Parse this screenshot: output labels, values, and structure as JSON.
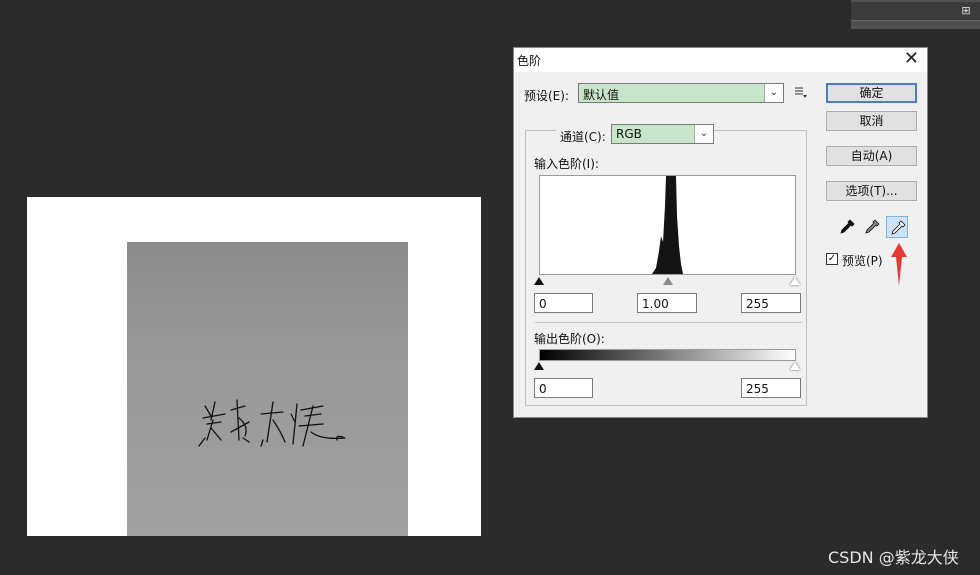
{
  "dialog": {
    "title": "色阶",
    "close_icon": "close-icon",
    "preset_label": "预设(E):",
    "preset_value": "默认值",
    "channel_label": "通道(C):",
    "channel_value": "RGB",
    "input_levels_label": "输入色阶(I):",
    "input_black": "0",
    "input_gamma": "1.00",
    "input_white": "255",
    "output_levels_label": "输出色阶(O):",
    "output_black": "0",
    "output_white": "255",
    "buttons": {
      "ok": "确定",
      "cancel": "取消",
      "auto": "自动(A)",
      "options": "选项(T)..."
    },
    "preview_label": "预览(P)",
    "preview_checked": true,
    "droppers": [
      "black-eyedropper-icon",
      "gray-eyedropper-icon",
      "white-eyedropper-icon"
    ],
    "active_dropper": "white-eyedropper-icon"
  },
  "colors": {
    "combo_bg": "#c7e6c9",
    "annotation_arrow": "#e53935",
    "workspace_bg": "#2b2b2b"
  },
  "watermark": "CSDN @紫龙大侠"
}
